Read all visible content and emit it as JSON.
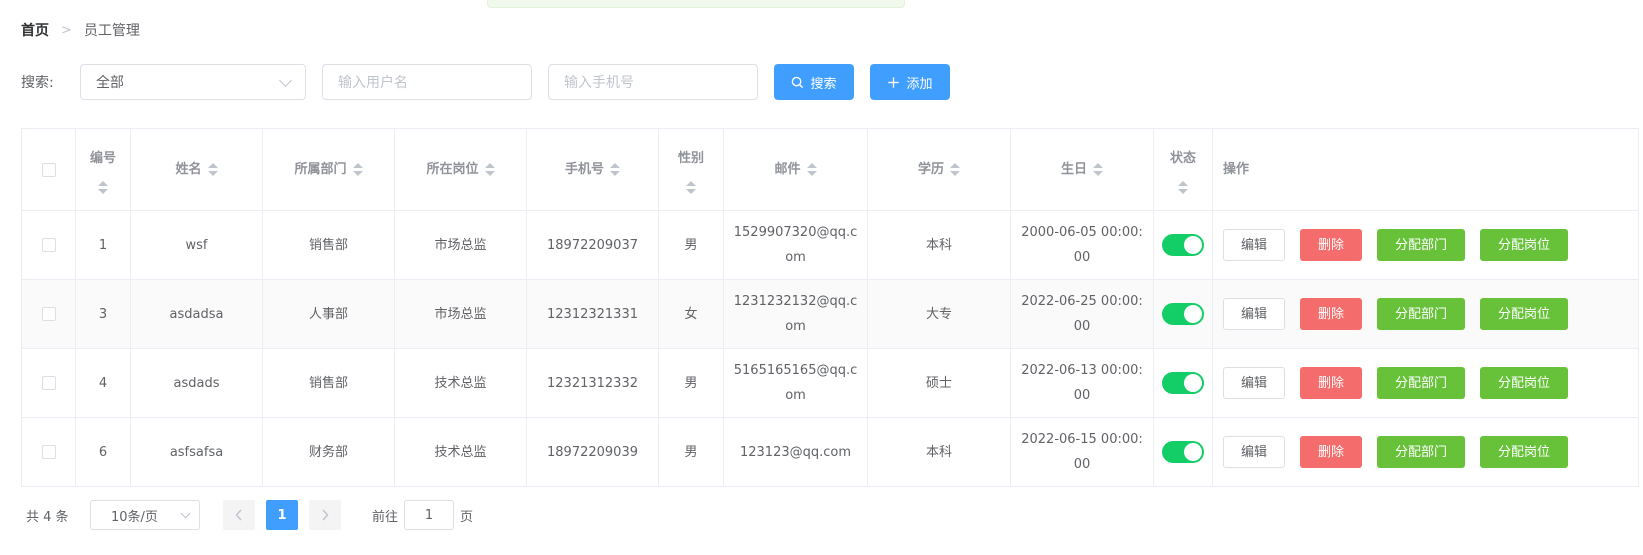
{
  "breadcrumb": {
    "home": "首页",
    "separator": ">",
    "current": "员工管理"
  },
  "search": {
    "label": "搜索:",
    "select_value": "全部",
    "user_placeholder": "输入用户名",
    "phone_placeholder": "输入手机号",
    "search_button": "搜索",
    "add_button": "添加"
  },
  "table": {
    "headers": {
      "id": "编号",
      "name": "姓名",
      "dept": "所属部门",
      "post": "所在岗位",
      "phone": "手机号",
      "sex": "性别",
      "mail": "邮件",
      "edu": "学历",
      "birth": "生日",
      "status": "状态",
      "op": "操作"
    },
    "rows": [
      {
        "id": "1",
        "name": "wsf",
        "dept": "销售部",
        "post": "市场总监",
        "phone": "18972209037",
        "sex": "男",
        "mail": "1529907320@qq.com",
        "edu": "本科",
        "birth": "2000-06-05 00:00:00",
        "status": true
      },
      {
        "id": "3",
        "name": "asdadsa",
        "dept": "人事部",
        "post": "市场总监",
        "phone": "12312321331",
        "sex": "女",
        "mail": "1231232132@qq.com",
        "edu": "大专",
        "birth": "2022-06-25 00:00:00",
        "status": true
      },
      {
        "id": "4",
        "name": "asdads",
        "dept": "销售部",
        "post": "技术总监",
        "phone": "12321312332",
        "sex": "男",
        "mail": "5165165165@qq.com",
        "edu": "硕士",
        "birth": "2022-06-13 00:00:00",
        "status": true
      },
      {
        "id": "6",
        "name": "asfsafsa",
        "dept": "财务部",
        "post": "技术总监",
        "phone": "18972209039",
        "sex": "男",
        "mail": "123123@qq.com",
        "edu": "本科",
        "birth": "2022-06-15 00:00:00",
        "status": true
      }
    ],
    "op_labels": {
      "edit": "编辑",
      "delete": "删除",
      "assign_dept": "分配部门",
      "assign_post": "分配岗位"
    }
  },
  "pagination": {
    "total_text": "共 4 条",
    "page_size": "10条/页",
    "current_page": "1",
    "goto_label": "前往",
    "goto_value": "1",
    "goto_suffix": "页"
  },
  "colors": {
    "primary": "#409eff",
    "danger": "#f56c6c",
    "success": "#67c23a",
    "switch_on": "#13ce66"
  }
}
